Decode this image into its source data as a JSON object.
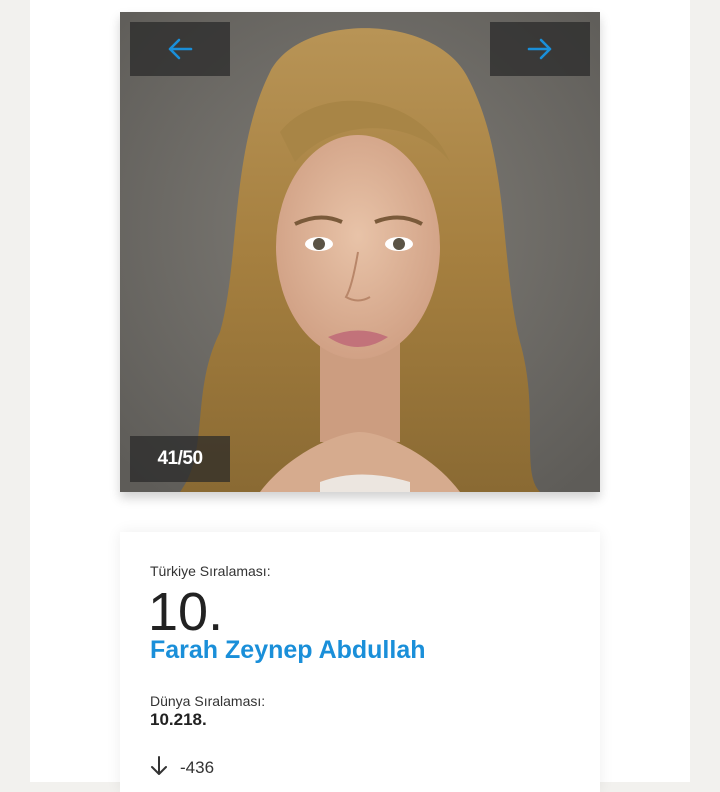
{
  "gallery": {
    "counter": "41/50",
    "prev_icon": "arrow-left-icon",
    "next_icon": "arrow-right-icon",
    "accent_color": "#1a8fd9"
  },
  "ranking": {
    "turkey_label": "Türkiye Sıralaması:",
    "turkey_rank": "10.",
    "name": "Farah Zeynep Abdullah",
    "world_label": "Dünya Sıralaması:",
    "world_rank": "10.218.",
    "change_icon": "arrow-down-icon",
    "change_value": "-436"
  }
}
